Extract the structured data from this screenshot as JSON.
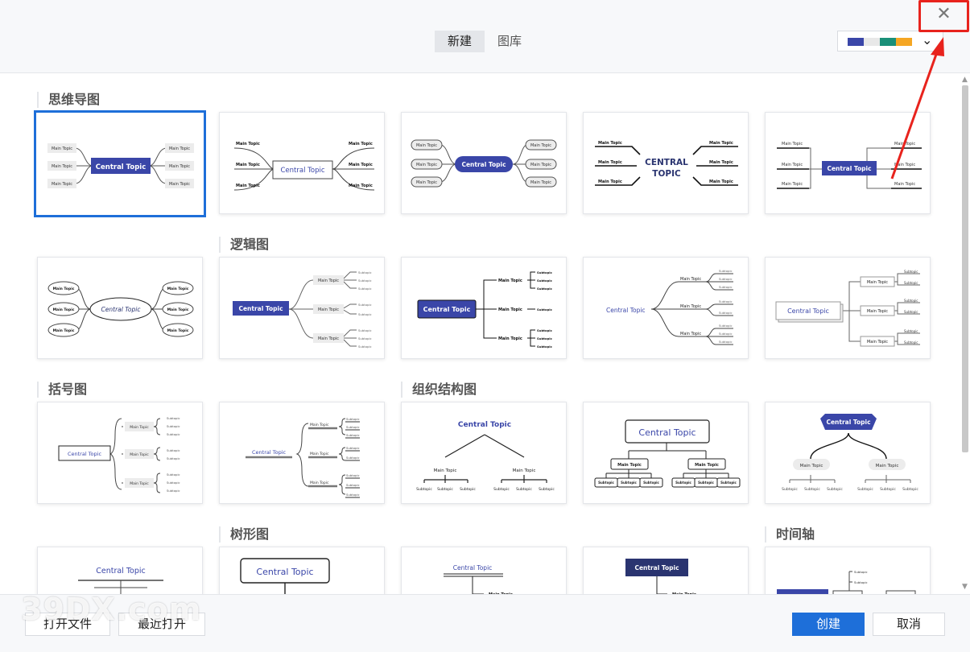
{
  "header": {
    "tabs": [
      {
        "label": "新建",
        "active": true
      },
      {
        "label": "图库",
        "active": false
      }
    ],
    "theme_swatch_colors": [
      "#3a46a8",
      "#e8e8e8",
      "#1a8f78",
      "#f5a623"
    ],
    "close_icon": "close-icon",
    "accent_color": "#1e6fd9",
    "highlight_color": "#e8231d"
  },
  "sections": {
    "mindmap": "思维导图",
    "logic": "逻辑图",
    "brace": "括号图",
    "org": "组织结构图",
    "tree": "树形图",
    "timeline": "时间轴"
  },
  "labels": {
    "central": "Central Topic",
    "central_caps_1": "CENTRAL",
    "central_caps_2": "TOPIC",
    "main": "Main Topic",
    "sub": "Subtopic"
  },
  "footer": {
    "open_file": "打开文件",
    "recent": "最近打开",
    "create": "创建",
    "cancel": "取消"
  },
  "watermark": "39DX.com"
}
